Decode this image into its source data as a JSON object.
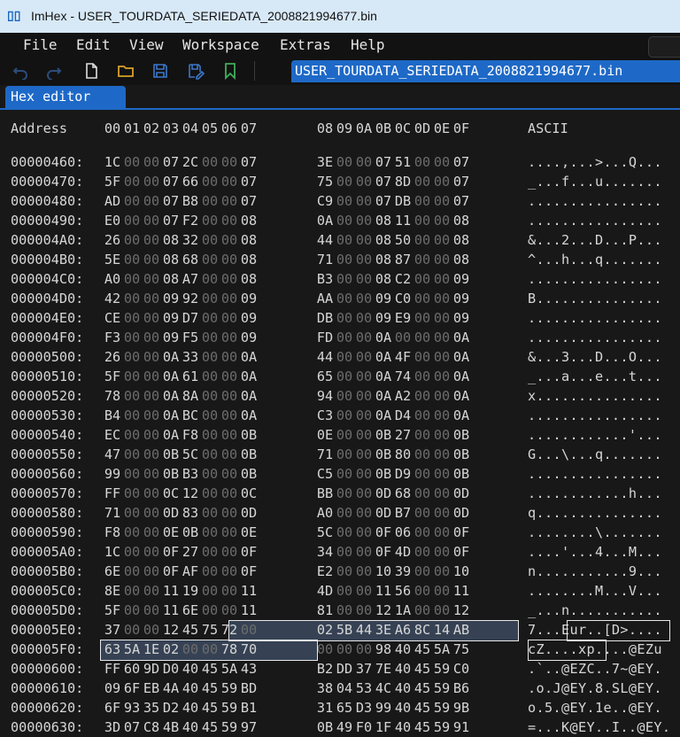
{
  "window": {
    "title": "ImHex - USER_TOURDATA_SERIEDATA_2008821994677.bin",
    "app_icon": "imhex-logo-icon"
  },
  "menu": [
    "File",
    "Edit",
    "View",
    "Workspace",
    "Extras",
    "Help"
  ],
  "toolbar": {
    "icons": [
      "undo-icon",
      "redo-icon",
      "new-file-icon",
      "open-folder-icon",
      "save-icon",
      "save-as-icon",
      "bookmark-icon"
    ],
    "file_tab_label": "USER_TOURDATA_SERIEDATA_2008821994677.bin"
  },
  "view_tab": {
    "label": "Hex editor"
  },
  "hex": {
    "header": {
      "address_label": "Address",
      "columns": [
        "00",
        "01",
        "02",
        "03",
        "04",
        "05",
        "06",
        "07",
        "08",
        "09",
        "0A",
        "0B",
        "0C",
        "0D",
        "0E",
        "0F"
      ],
      "ascii_label": "ASCII"
    },
    "rows": [
      {
        "address": "00000460:",
        "bytes": [
          "1C",
          "00",
          "00",
          "07",
          "2C",
          "00",
          "00",
          "07",
          "3E",
          "00",
          "00",
          "07",
          "51",
          "00",
          "00",
          "07"
        ],
        "ascii": "....,...>...Q..."
      },
      {
        "address": "00000470:",
        "bytes": [
          "5F",
          "00",
          "00",
          "07",
          "66",
          "00",
          "00",
          "07",
          "75",
          "00",
          "00",
          "07",
          "8D",
          "00",
          "00",
          "07"
        ],
        "ascii": "_...f...u......."
      },
      {
        "address": "00000480:",
        "bytes": [
          "AD",
          "00",
          "00",
          "07",
          "B8",
          "00",
          "00",
          "07",
          "C9",
          "00",
          "00",
          "07",
          "DB",
          "00",
          "00",
          "07"
        ],
        "ascii": "................"
      },
      {
        "address": "00000490:",
        "bytes": [
          "E0",
          "00",
          "00",
          "07",
          "F2",
          "00",
          "00",
          "08",
          "0A",
          "00",
          "00",
          "08",
          "11",
          "00",
          "00",
          "08"
        ],
        "ascii": "................"
      },
      {
        "address": "000004A0:",
        "bytes": [
          "26",
          "00",
          "00",
          "08",
          "32",
          "00",
          "00",
          "08",
          "44",
          "00",
          "00",
          "08",
          "50",
          "00",
          "00",
          "08"
        ],
        "ascii": "&...2...D...P..."
      },
      {
        "address": "000004B0:",
        "bytes": [
          "5E",
          "00",
          "00",
          "08",
          "68",
          "00",
          "00",
          "08",
          "71",
          "00",
          "00",
          "08",
          "87",
          "00",
          "00",
          "08"
        ],
        "ascii": "^...h...q......."
      },
      {
        "address": "000004C0:",
        "bytes": [
          "A0",
          "00",
          "00",
          "08",
          "A7",
          "00",
          "00",
          "08",
          "B3",
          "00",
          "00",
          "08",
          "C2",
          "00",
          "00",
          "09"
        ],
        "ascii": "................"
      },
      {
        "address": "000004D0:",
        "bytes": [
          "42",
          "00",
          "00",
          "09",
          "92",
          "00",
          "00",
          "09",
          "AA",
          "00",
          "00",
          "09",
          "C0",
          "00",
          "00",
          "09"
        ],
        "ascii": "B..............."
      },
      {
        "address": "000004E0:",
        "bytes": [
          "CE",
          "00",
          "00",
          "09",
          "D7",
          "00",
          "00",
          "09",
          "DB",
          "00",
          "00",
          "09",
          "E9",
          "00",
          "00",
          "09"
        ],
        "ascii": "................"
      },
      {
        "address": "000004F0:",
        "bytes": [
          "F3",
          "00",
          "00",
          "09",
          "F5",
          "00",
          "00",
          "09",
          "FD",
          "00",
          "00",
          "0A",
          "00",
          "00",
          "00",
          "0A"
        ],
        "ascii": "................"
      },
      {
        "address": "00000500:",
        "bytes": [
          "26",
          "00",
          "00",
          "0A",
          "33",
          "00",
          "00",
          "0A",
          "44",
          "00",
          "00",
          "0A",
          "4F",
          "00",
          "00",
          "0A"
        ],
        "ascii": "&...3...D...O..."
      },
      {
        "address": "00000510:",
        "bytes": [
          "5F",
          "00",
          "00",
          "0A",
          "61",
          "00",
          "00",
          "0A",
          "65",
          "00",
          "00",
          "0A",
          "74",
          "00",
          "00",
          "0A"
        ],
        "ascii": "_...a...e...t..."
      },
      {
        "address": "00000520:",
        "bytes": [
          "78",
          "00",
          "00",
          "0A",
          "8A",
          "00",
          "00",
          "0A",
          "94",
          "00",
          "00",
          "0A",
          "A2",
          "00",
          "00",
          "0A"
        ],
        "ascii": "x..............."
      },
      {
        "address": "00000530:",
        "bytes": [
          "B4",
          "00",
          "00",
          "0A",
          "BC",
          "00",
          "00",
          "0A",
          "C3",
          "00",
          "00",
          "0A",
          "D4",
          "00",
          "00",
          "0A"
        ],
        "ascii": "................"
      },
      {
        "address": "00000540:",
        "bytes": [
          "EC",
          "00",
          "00",
          "0A",
          "F8",
          "00",
          "00",
          "0B",
          "0E",
          "00",
          "00",
          "0B",
          "27",
          "00",
          "00",
          "0B"
        ],
        "ascii": "............'..."
      },
      {
        "address": "00000550:",
        "bytes": [
          "47",
          "00",
          "00",
          "0B",
          "5C",
          "00",
          "00",
          "0B",
          "71",
          "00",
          "00",
          "0B",
          "80",
          "00",
          "00",
          "0B"
        ],
        "ascii": "G...\\...q......."
      },
      {
        "address": "00000560:",
        "bytes": [
          "99",
          "00",
          "00",
          "0B",
          "B3",
          "00",
          "00",
          "0B",
          "C5",
          "00",
          "00",
          "0B",
          "D9",
          "00",
          "00",
          "0B"
        ],
        "ascii": "................"
      },
      {
        "address": "00000570:",
        "bytes": [
          "FF",
          "00",
          "00",
          "0C",
          "12",
          "00",
          "00",
          "0C",
          "BB",
          "00",
          "00",
          "0D",
          "68",
          "00",
          "00",
          "0D"
        ],
        "ascii": "............h..."
      },
      {
        "address": "00000580:",
        "bytes": [
          "71",
          "00",
          "00",
          "0D",
          "83",
          "00",
          "00",
          "0D",
          "A0",
          "00",
          "00",
          "0D",
          "B7",
          "00",
          "00",
          "0D"
        ],
        "ascii": "q..............."
      },
      {
        "address": "00000590:",
        "bytes": [
          "F8",
          "00",
          "00",
          "0E",
          "0B",
          "00",
          "00",
          "0E",
          "5C",
          "00",
          "00",
          "0F",
          "06",
          "00",
          "00",
          "0F"
        ],
        "ascii": "........\\......."
      },
      {
        "address": "000005A0:",
        "bytes": [
          "1C",
          "00",
          "00",
          "0F",
          "27",
          "00",
          "00",
          "0F",
          "34",
          "00",
          "00",
          "0F",
          "4D",
          "00",
          "00",
          "0F"
        ],
        "ascii": "....'...4...M..."
      },
      {
        "address": "000005B0:",
        "bytes": [
          "6E",
          "00",
          "00",
          "0F",
          "AF",
          "00",
          "00",
          "0F",
          "E2",
          "00",
          "00",
          "10",
          "39",
          "00",
          "00",
          "10"
        ],
        "ascii": "n...........9..."
      },
      {
        "address": "000005C0:",
        "bytes": [
          "8E",
          "00",
          "00",
          "11",
          "19",
          "00",
          "00",
          "11",
          "4D",
          "00",
          "00",
          "11",
          "56",
          "00",
          "00",
          "11"
        ],
        "ascii": "........M...V..."
      },
      {
        "address": "000005D0:",
        "bytes": [
          "5F",
          "00",
          "00",
          "11",
          "6E",
          "00",
          "00",
          "11",
          "81",
          "00",
          "00",
          "12",
          "1A",
          "00",
          "00",
          "12"
        ],
        "ascii": "_...n..........."
      },
      {
        "address": "000005E0:",
        "bytes": [
          "37",
          "00",
          "00",
          "12",
          "45",
          "75",
          "72",
          "00",
          "02",
          "5B",
          "44",
          "3E",
          "A6",
          "8C",
          "14",
          "AB"
        ],
        "ascii": "7...Eur..[D>...."
      },
      {
        "address": "000005F0:",
        "bytes": [
          "63",
          "5A",
          "1E",
          "02",
          "00",
          "00",
          "78",
          "70",
          "00",
          "00",
          "00",
          "98",
          "40",
          "45",
          "5A",
          "75"
        ],
        "ascii": "cZ....xp....@EZu"
      },
      {
        "address": "00000600:",
        "bytes": [
          "FF",
          "60",
          "9D",
          "D0",
          "40",
          "45",
          "5A",
          "43",
          "B2",
          "DD",
          "37",
          "7E",
          "40",
          "45",
          "59",
          "C0"
        ],
        "ascii": ".`..@EZC..7~@EY."
      },
      {
        "address": "00000610:",
        "bytes": [
          "09",
          "6F",
          "EB",
          "4A",
          "40",
          "45",
          "59",
          "BD",
          "38",
          "04",
          "53",
          "4C",
          "40",
          "45",
          "59",
          "B6"
        ],
        "ascii": ".o.J@EY.8.SL@EY."
      },
      {
        "address": "00000620:",
        "bytes": [
          "6F",
          "93",
          "35",
          "D2",
          "40",
          "45",
          "59",
          "B1",
          "31",
          "65",
          "D3",
          "99",
          "40",
          "45",
          "59",
          "9B"
        ],
        "ascii": "o.5.@EY.1e..@EY."
      },
      {
        "address": "00000630:",
        "bytes": [
          "3D",
          "07",
          "C8",
          "4B",
          "40",
          "45",
          "59",
          "97",
          "0B",
          "49",
          "F0",
          "1F",
          "40",
          "45",
          "59",
          "91"
        ],
        "ascii": "=...K@EY..I..@EY."
      }
    ]
  },
  "colors": {
    "accent": "#1e69c7",
    "zero_byte": "#6c6c6c",
    "text": "#d6d6d6",
    "selection": "#364254",
    "background": "#181818"
  }
}
